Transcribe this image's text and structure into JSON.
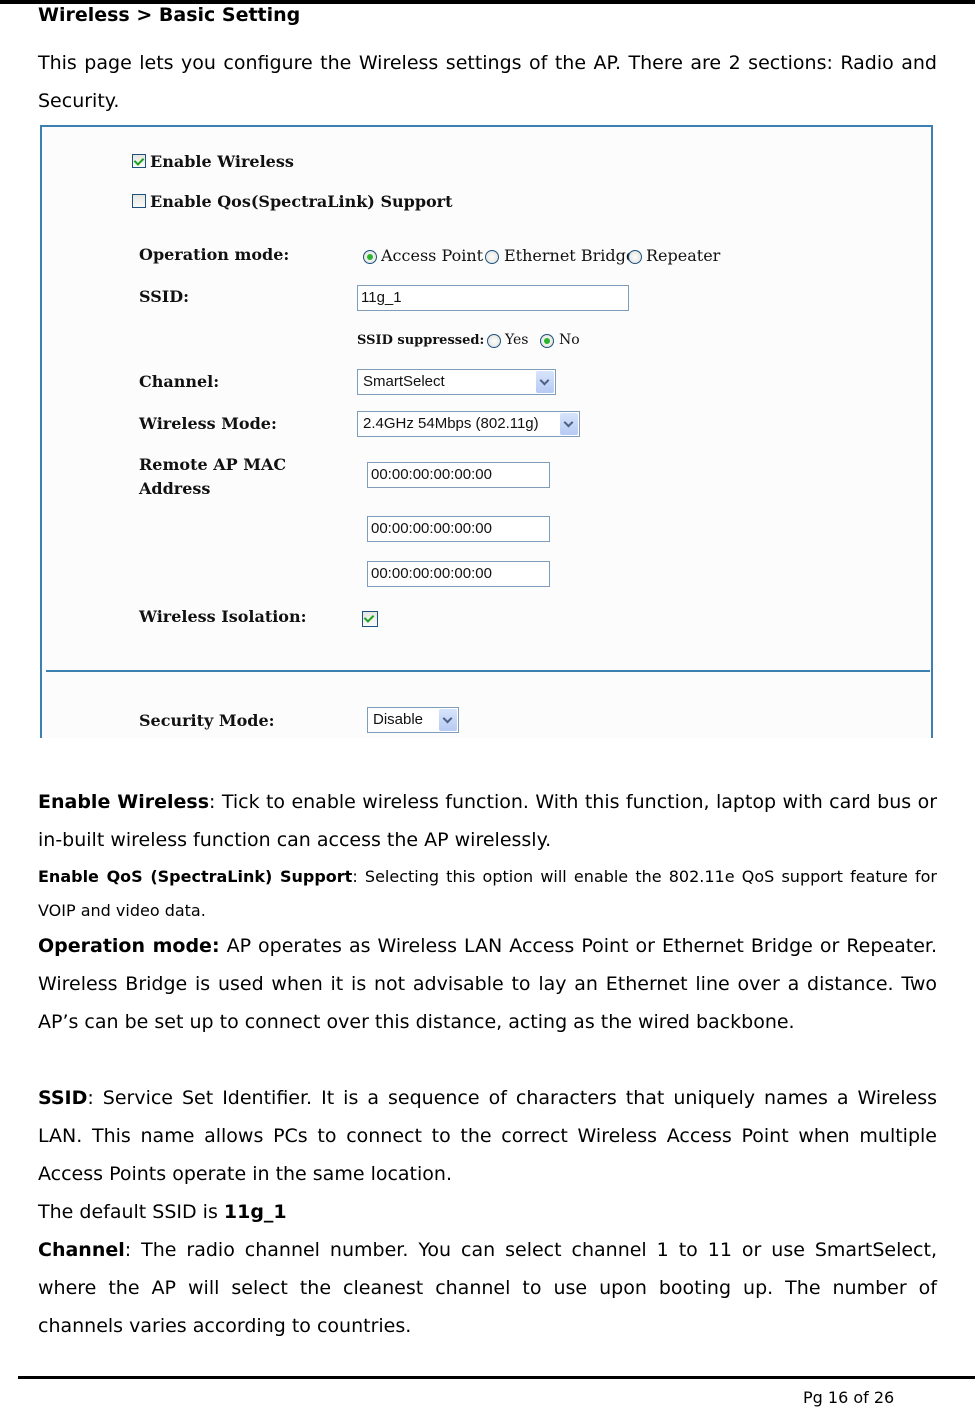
{
  "document": {
    "heading": "Wireless > Basic Setting",
    "intro": "This page lets you configure the Wireless settings of the AP. There are 2 sections: Radio and Security.",
    "page_number": "Pg 16 of 26"
  },
  "screenshot": {
    "enable_wireless": {
      "label": "Enable Wireless",
      "checked": true
    },
    "enable_qos": {
      "label": "Enable Qos(SpectraLink) Support",
      "checked": false
    },
    "operation_mode": {
      "label": "Operation mode:",
      "options": [
        "Access Point",
        "Ethernet Bridge",
        "Repeater"
      ],
      "selected": "Access Point"
    },
    "ssid": {
      "label": "SSID:",
      "value": "11g_1"
    },
    "ssid_suppressed": {
      "label": "SSID suppressed:",
      "options": [
        "Yes",
        "No"
      ],
      "selected": "No"
    },
    "channel": {
      "label": "Channel:",
      "value": "SmartSelect"
    },
    "wireless_mode": {
      "label": "Wireless Mode:",
      "value": "2.4GHz 54Mbps (802.11g)"
    },
    "remote_ap_mac": {
      "label_line1": "Remote AP MAC",
      "label_line2": "Address",
      "values": [
        "00:00:00:00:00:00",
        "00:00:00:00:00:00",
        "00:00:00:00:00:00"
      ]
    },
    "wireless_isolation": {
      "label": "Wireless Isolation:",
      "checked": true
    },
    "security_mode": {
      "label": "Security Mode:",
      "value": "Disable"
    }
  },
  "descriptions": {
    "enable_wireless": {
      "term": "Enable Wireless",
      "text": ": Tick to enable wireless function. With this function, laptop with card bus or in-built wireless function can access the AP wirelessly."
    },
    "enable_qos": {
      "term": "Enable QoS (SpectraLink) Support",
      "text": ": Selecting this option will enable the 802.11e QoS support feature for VOIP and video data."
    },
    "operation_mode": {
      "term": "Operation mode:",
      "text": " AP operates as Wireless LAN Access Point or Ethernet Bridge or Repeater. Wireless Bridge is used when it is not advisable to lay an Ethernet line over a distance. Two AP’s can be set up to connect over this distance, acting as the wired backbone."
    },
    "ssid": {
      "term": "SSID",
      "text": ": Service Set Identifier. It is a sequence of characters that uniquely names a Wireless LAN. This name allows PCs to connect to the correct Wireless Access Point when multiple Access Points operate in the same location."
    },
    "default_ssid": {
      "prefix": "The default SSID is ",
      "value": "11g_1"
    },
    "channel": {
      "term": "Channel",
      "text": ": The radio channel number. You can select channel 1 to 11 or use SmartSelect, where the AP will select the cleanest channel to use upon booting up. The number of channels varies according to countries."
    }
  }
}
